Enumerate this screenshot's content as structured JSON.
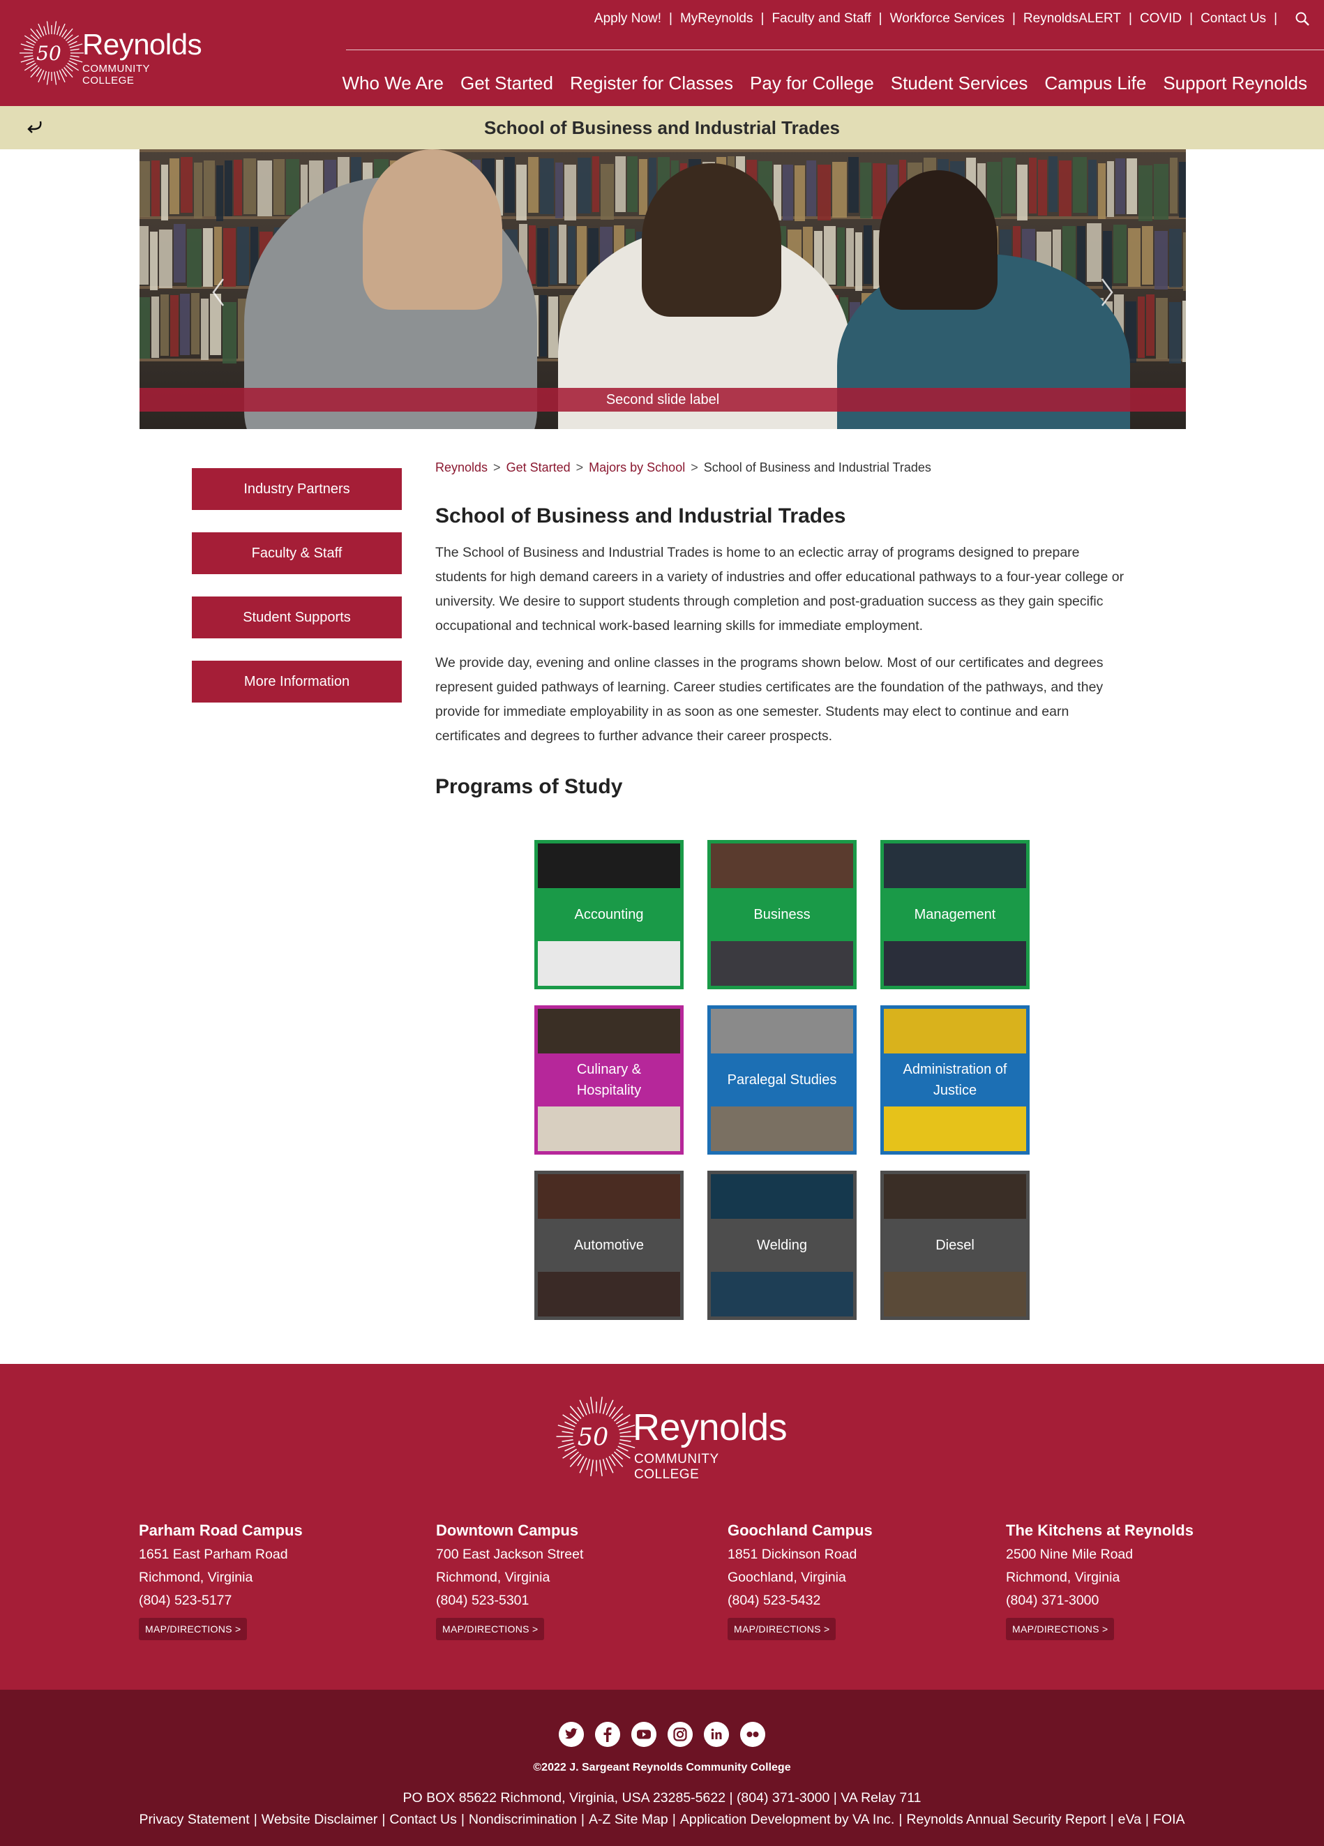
{
  "header": {
    "logo": {
      "badge": "50",
      "name": "Reynolds",
      "subtitle": "COMMUNITY COLLEGE"
    },
    "utility_links": [
      "Apply Now!",
      "MyReynolds",
      "Faculty and Staff",
      "Workforce Services",
      "ReynoldsALERT",
      "COVID",
      "Contact Us"
    ],
    "search_icon": "search-icon",
    "main_nav": [
      "Who We Are",
      "Get Started",
      "Register for Classes",
      "Pay for College",
      "Student Services",
      "Campus Life",
      "Support Reynolds"
    ]
  },
  "subbar": {
    "back_icon": "back-arrow-icon",
    "title": "School of Business and Industrial Trades"
  },
  "hero": {
    "caption": "Second slide label",
    "prev_icon": "chevron-left-icon",
    "next_icon": "chevron-right-icon"
  },
  "sidebar": {
    "buttons": [
      "Industry Partners",
      "Faculty & Staff",
      "Student Supports",
      "More Information"
    ]
  },
  "breadcrumb": {
    "links": [
      "Reynolds",
      "Get Started",
      "Majors by School"
    ],
    "separator": ">",
    "current": "School of Business and Industrial Trades"
  },
  "main": {
    "heading": "School of Business and Industrial Trades",
    "paragraphs": [
      "The School of Business and Industrial Trades is home to an eclectic array of programs designed to prepare students for high demand careers in a variety of industries and offer educational pathways to a four-year college or university. We desire to support students through completion and post-graduation success as they gain specific occupational and technical work-based learning skills for immediate employment.",
      "We provide day, evening and online classes in the programs shown below. Most of our certificates and degrees represent guided pathways of learning. Career studies certificates are the foundation of the pathways, and they provide for immediate employability in as soon as one semester. Students may elect to continue and earn certificates and degrees to further advance their career prospects."
    ],
    "programs_heading": "Programs of Study",
    "programs": [
      {
        "label": "Accounting",
        "color": "#1a9a48"
      },
      {
        "label": "Business",
        "color": "#1a9a48"
      },
      {
        "label": "Management",
        "color": "#1a9a48"
      },
      {
        "label": "Culinary & Hospitality",
        "color": "#b6279a"
      },
      {
        "label": "Paralegal Studies",
        "color": "#1c6fb4"
      },
      {
        "label": "Administration of Justice",
        "color": "#1c6fb4"
      },
      {
        "label": "Automotive",
        "color": "#4d4d4d"
      },
      {
        "label": "Welding",
        "color": "#4d4d4d"
      },
      {
        "label": "Diesel",
        "color": "#4d4d4d"
      }
    ]
  },
  "footer": {
    "logo": {
      "badge": "50",
      "name": "Reynolds",
      "subtitle": "COMMUNITY COLLEGE"
    },
    "campuses": [
      {
        "name": "Parham Road Campus",
        "street": "1651 East Parham Road",
        "city": "Richmond, Virginia",
        "phone": "(804) 523-5177",
        "map": "MAP/DIRECTIONS  >"
      },
      {
        "name": "Downtown Campus",
        "street": "700 East Jackson Street",
        "city": "Richmond, Virginia",
        "phone": "(804) 523-5301",
        "map": "MAP/DIRECTIONS  >"
      },
      {
        "name": "Goochland Campus",
        "street": "1851 Dickinson Road",
        "city": "Goochland, Virginia",
        "phone": "(804) 523-5432",
        "map": "MAP/DIRECTIONS  >"
      },
      {
        "name": "The Kitchens at Reynolds",
        "street": "2500 Nine Mile Road",
        "city": "Richmond, Virginia",
        "phone": "(804) 371-3000",
        "map": "MAP/DIRECTIONS  >"
      }
    ],
    "social_icons": [
      "twitter-icon",
      "facebook-icon",
      "youtube-icon",
      "instagram-icon",
      "linkedin-icon",
      "flickr-icon"
    ],
    "copyright": "©2022 J. Sargeant Reynolds Community College",
    "address": "PO BOX 85622 Richmond, Virginia, USA 23285-5622 | (804) 371-3000 | VA Relay 711",
    "legal_links": [
      "Privacy Statement",
      "Website Disclaimer",
      "Contact Us",
      "Nondiscrimination",
      "A-Z Site Map",
      "Application Development by VA Inc.",
      "Reynolds Annual Security Report",
      "eVa",
      "FOIA"
    ]
  },
  "colors": {
    "brand": "#a51e37",
    "dark": "#6c1324",
    "subbar": "#e2ddb5",
    "link": "#8a1830"
  }
}
